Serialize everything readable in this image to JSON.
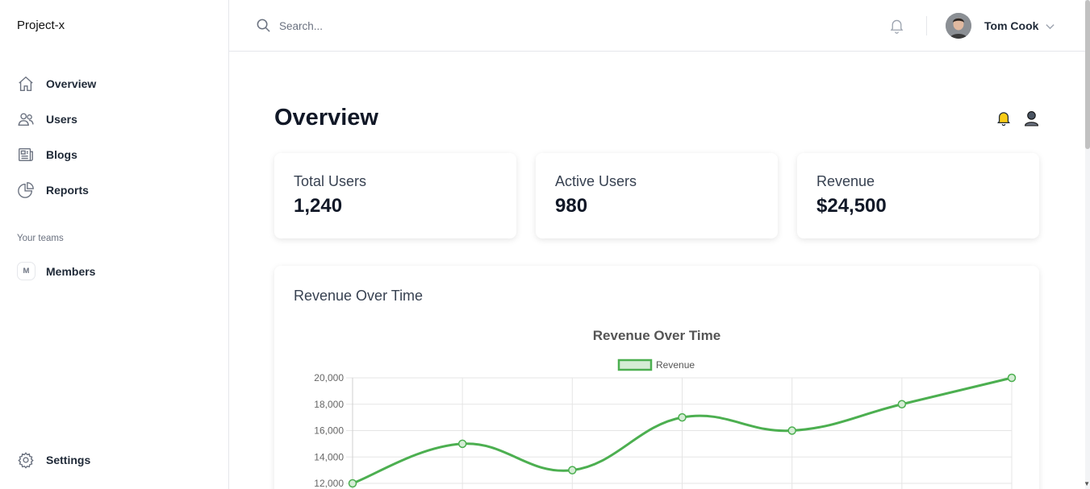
{
  "app": {
    "brand": "Project-x"
  },
  "sidebar": {
    "items": [
      {
        "label": "Overview",
        "icon": "home-icon"
      },
      {
        "label": "Users",
        "icon": "users-icon"
      },
      {
        "label": "Blogs",
        "icon": "newspaper-icon"
      },
      {
        "label": "Reports",
        "icon": "pie-chart-icon"
      }
    ],
    "teams_label": "Your teams",
    "teams": [
      {
        "initial": "M",
        "label": "Members"
      }
    ],
    "settings_label": "Settings"
  },
  "topbar": {
    "search_placeholder": "Search...",
    "user_name": "Tom Cook"
  },
  "main": {
    "title": "Overview",
    "stats": [
      {
        "label": "Total Users",
        "value": "1,240"
      },
      {
        "label": "Active Users",
        "value": "980"
      },
      {
        "label": "Revenue",
        "value": "$24,500"
      }
    ],
    "chart_card_title": "Revenue Over Time"
  },
  "colors": {
    "accent_green": "#4caf50",
    "legend_fill": "#d5ecd5",
    "bell_yellow": "#facc15"
  },
  "chart_data": {
    "type": "line",
    "title": "Revenue Over Time",
    "series": [
      {
        "name": "Revenue",
        "values": [
          12000,
          15000,
          13000,
          17000,
          16000,
          18000,
          20000
        ]
      }
    ],
    "y_ticks": [
      "12,000",
      "14,000",
      "16,000",
      "18,000",
      "20,000"
    ],
    "ylim": [
      12000,
      20000
    ],
    "grid": true,
    "legend_position": "top"
  }
}
